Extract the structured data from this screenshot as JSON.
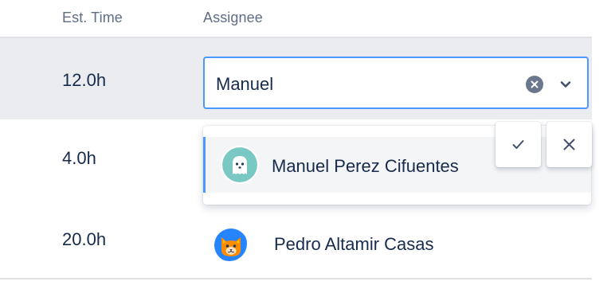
{
  "table": {
    "headers": {
      "est_time": "Est. Time",
      "assignee": "Assignee"
    },
    "rows": [
      {
        "est_time": "12.0h",
        "assignee_input": "Manuel",
        "editing": true
      },
      {
        "est_time": "4.0h"
      },
      {
        "est_time": "20.0h",
        "assignee": "Pedro Altamir Casas",
        "avatar_icon": "cat-avatar"
      }
    ]
  },
  "dropdown": {
    "options": [
      {
        "label": "Manuel Perez Cifuentes",
        "avatar_icon": "ghost-avatar",
        "highlighted": true
      }
    ]
  },
  "actions": {
    "confirm_icon": "check-icon",
    "cancel_icon": "close-icon"
  },
  "colors": {
    "focus_border": "#4c9aff",
    "selected_row_bg": "#ebecf0",
    "text": "#172b4d",
    "header_text": "#5e6c84"
  }
}
